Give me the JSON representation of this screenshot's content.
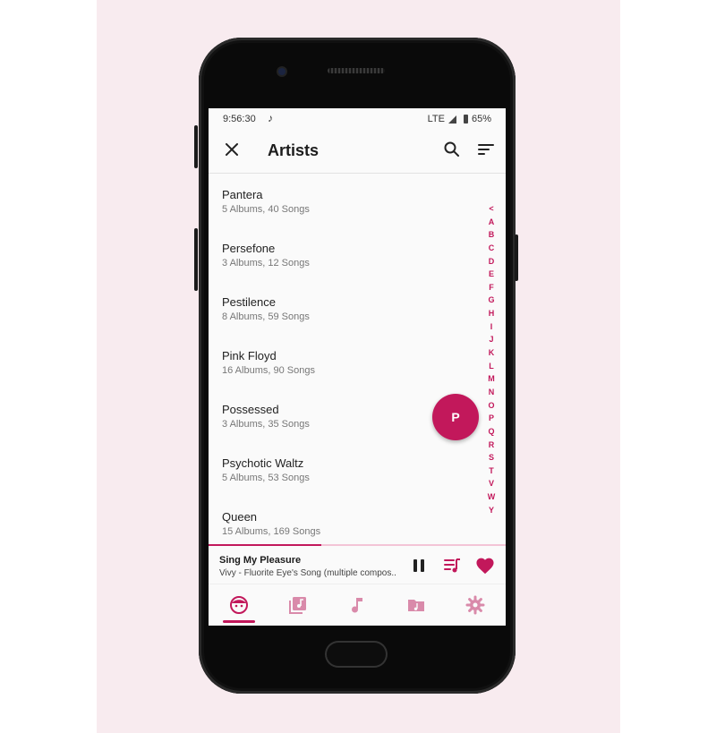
{
  "status_bar": {
    "time": "9:56:30",
    "network": "LTE",
    "battery": "65%",
    "music_icon": "music-note-icon"
  },
  "app_bar": {
    "title": "Artists",
    "close_icon": "close-icon",
    "search_icon": "search-icon",
    "sort_icon": "sort-icon"
  },
  "artists": [
    {
      "name": "Pantera",
      "meta": "5 Albums, 40 Songs"
    },
    {
      "name": "Persefone",
      "meta": "3 Albums, 12 Songs"
    },
    {
      "name": "Pestilence",
      "meta": "8 Albums, 59 Songs"
    },
    {
      "name": "Pink Floyd",
      "meta": "16 Albums, 90 Songs"
    },
    {
      "name": "Possessed",
      "meta": "3 Albums, 35 Songs"
    },
    {
      "name": "Psychotic Waltz",
      "meta": "5 Albums, 53 Songs"
    },
    {
      "name": "Queen",
      "meta": "15 Albums, 169 Songs"
    }
  ],
  "fast_scroller": {
    "letters": [
      "<",
      "A",
      "B",
      "C",
      "D",
      "E",
      "F",
      "G",
      "H",
      "I",
      "J",
      "K",
      "L",
      "M",
      "N",
      "O",
      "P",
      "Q",
      "R",
      "S",
      "T",
      "V",
      "W",
      "Y"
    ],
    "current": "P"
  },
  "now_playing": {
    "song": "Sing My Pleasure",
    "subtitle": "Vivy - Fluorite Eye's Song (multiple compos..",
    "progress": 0.38
  },
  "bottom_nav": {
    "items": [
      "artist-face-icon",
      "album-icon",
      "music-note-icon",
      "folder-music-icon",
      "settings-gear-icon"
    ],
    "selected": 0
  },
  "colors": {
    "accent": "#c2185b",
    "accent_light": "#f3c4d6",
    "background": "#f8ebef"
  }
}
